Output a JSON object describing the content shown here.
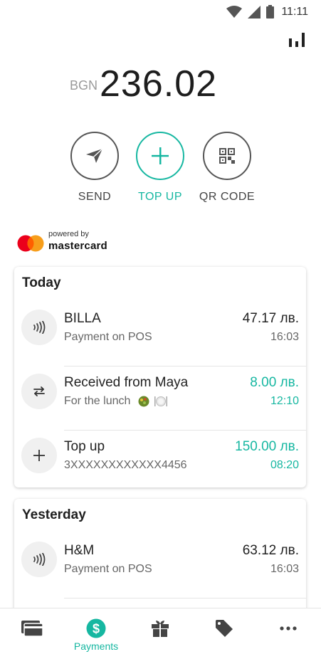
{
  "status_bar": {
    "time": "11:11"
  },
  "balance": {
    "currency": "BGN",
    "amount": "236.02"
  },
  "actions": [
    {
      "label": "SEND",
      "icon": "send-icon"
    },
    {
      "label": "TOP UP",
      "icon": "plus-icon"
    },
    {
      "label": "QR CODE",
      "icon": "qr-code-icon"
    }
  ],
  "mastercard": {
    "powered_by": "powered by",
    "brand": "mastercard"
  },
  "colors": {
    "accent": "#16b7a1",
    "mc_red": "#eb001b",
    "mc_orange": "#f79e1b",
    "mc_overlap": "#ff5f00"
  },
  "today": {
    "title": "Today",
    "transactions": [
      {
        "name": "BILLA",
        "description": "Payment on POS",
        "amount": "47.17 лв.",
        "time": "16:03",
        "icon": "contactless-icon"
      },
      {
        "name": "Received from Maya",
        "description": "For the lunch",
        "amount": "8.00 лв.",
        "time": "12:10",
        "icon": "transfer-arrows-icon"
      },
      {
        "name": "Top up",
        "description": "3XXXXXXXXXXXX4456",
        "amount": "150.00 лв.",
        "time": "08:20",
        "icon": "plus-icon"
      }
    ]
  },
  "yesterday": {
    "title": "Yesterday",
    "transactions": [
      {
        "name": "H&M",
        "description": "Payment on POS",
        "amount": "63.12 лв.",
        "time": "16:03",
        "icon": "contactless-icon"
      }
    ]
  },
  "bottom_nav": [
    {
      "label": "",
      "icon": "cards-icon"
    },
    {
      "label": "Payments",
      "icon": "dollar-circle-icon"
    },
    {
      "label": "",
      "icon": "gift-icon"
    },
    {
      "label": "",
      "icon": "tag-icon"
    },
    {
      "label": "",
      "icon": "more-dots-icon"
    }
  ]
}
